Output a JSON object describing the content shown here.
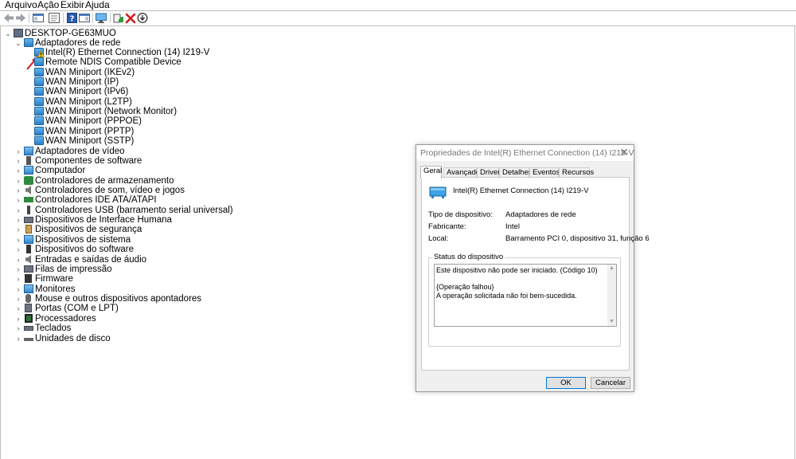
{
  "menu": [
    "Arquivo",
    "Ação",
    "Exibir",
    "Ajuda"
  ],
  "toolbar": {
    "icons": [
      "back-arrow-icon",
      "forward-arrow-icon",
      "show-hide-console-tree-icon",
      "properties-icon",
      "help-icon",
      "action-pane-icon",
      "monitor-icon",
      "update-driver-icon",
      "uninstall-icon",
      "download-icon"
    ]
  },
  "tree": {
    "root": "DESKTOP-GE63MUO",
    "network_category": "Adaptadores de rede",
    "network_children": [
      "Intel(R) Ethernet Connection (14) I219-V",
      "Remote NDIS Compatible Device",
      "WAN Miniport (IKEv2)",
      "WAN Miniport (IP)",
      "WAN Miniport (IPv6)",
      "WAN Miniport (L2TP)",
      "WAN Miniport (Network Monitor)",
      "WAN Miniport (PPPOE)",
      "WAN Miniport (PPTP)",
      "WAN Miniport (SSTP)"
    ],
    "categories": [
      "Adaptadores de vídeo",
      "Componentes de software",
      "Computador",
      "Controladores de armazenamento",
      "Controladores de som, vídeo e jogos",
      "Controladores IDE ATA/ATAPI",
      "Controladores USB (barramento serial universal)",
      "Dispositivos de Interface Humana",
      "Dispositivos de segurança",
      "Dispositivos de sistema",
      "Dispositivos do software",
      "Entradas e saídas de áudio",
      "Filas de impressão",
      "Firmware",
      "Monitores",
      "Mouse e outros dispositivos apontadores",
      "Portas (COM e LPT)",
      "Processadores",
      "Teclados",
      "Unidades de disco"
    ]
  },
  "dialog": {
    "title": "Propriedades de Intel(R) Ethernet Connection (14) I219-V",
    "tabs": [
      "Geral",
      "Avançado",
      "Driver",
      "Detalhes",
      "Eventos",
      "Recursos"
    ],
    "device_name": "Intel(R) Ethernet Connection (14) I219-V",
    "props": [
      {
        "label": "Tipo de dispositivo:",
        "value": "Adaptadores de rede"
      },
      {
        "label": "Fabricante:",
        "value": "Intel"
      },
      {
        "label": "Local:",
        "value": "Barramento PCI 0, dispositivo 31, função 6"
      }
    ],
    "status_label": "Status do dispositivo",
    "status_text": "Este dispositivo não pode ser iniciado. (Código 10)\n\n{Operação falhou}\nA operação solicitada não foi bem-sucedida.",
    "ok": "OK",
    "cancel": "Cancelar"
  },
  "colors": {
    "accent": "#0078d7",
    "error_red": "#d11a1a",
    "arrow_red": "#e0141e"
  }
}
